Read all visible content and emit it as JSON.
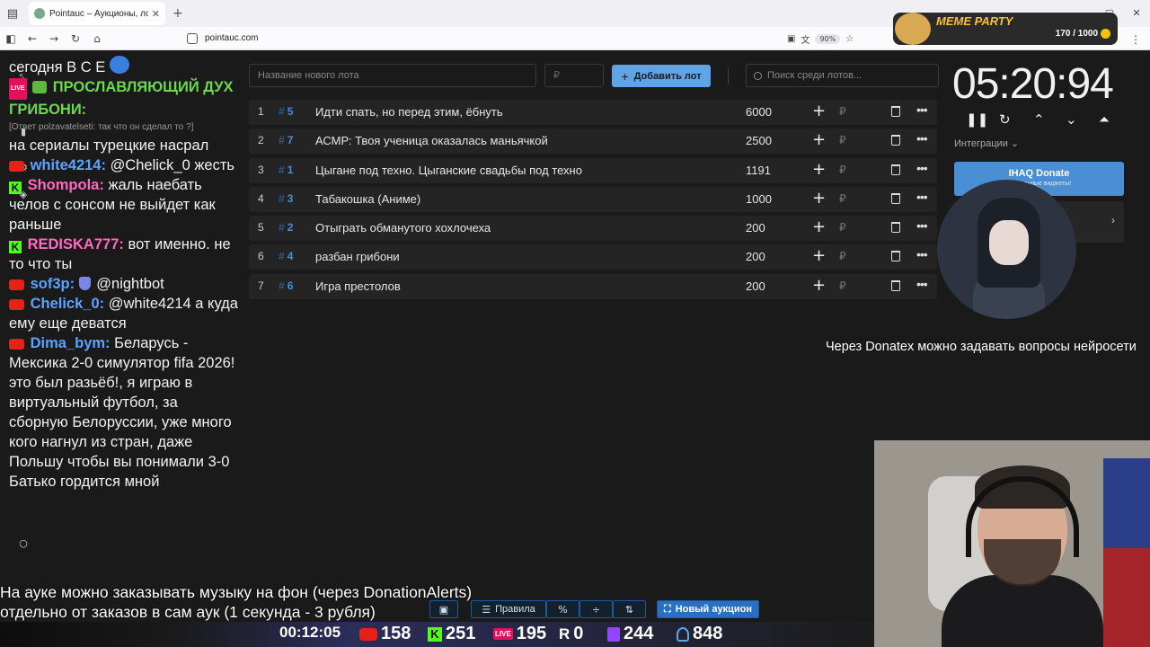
{
  "browser": {
    "tab_title": "Pointauc – Аукционы, лотереи",
    "tab_close": "✕",
    "new_tab": "+",
    "url": "pointauc.com",
    "zoom": "90%"
  },
  "meme_party": {
    "title": "MEME PARTY",
    "count": "170 / 1000"
  },
  "chat": {
    "m1": {
      "text": "сегодня В С Е"
    },
    "m2": {
      "text": "ПРОСЛАВЛЯЮЩИЙ ДУХ ГРИБОНИ:"
    },
    "m3": {
      "reply": "[Ответ polzavatelseti: так что он сделал то ?]",
      "text": "на сериалы турецкие насрал"
    },
    "m4": {
      "nick": "white4214:",
      "text": "@Chelick_0 жесть",
      "nick_color": "#5ea2ff"
    },
    "m5": {
      "nick": "Shompola:",
      "text": "жаль наебать челов с сонсом не выйдет как раньше",
      "nick_color": "#ff6ac0"
    },
    "m6": {
      "nick": "REDISKA777:",
      "text": "вот именно. не то что ты",
      "nick_color": "#ff6ac0"
    },
    "m7": {
      "nick": "sof3p:",
      "text": "@nightbot",
      "nick_color": "#5ea2ff"
    },
    "m8": {
      "nick": "Chelick_0:",
      "text": "@white4214 а куда ему еще деватся",
      "nick_color": "#5ea2ff"
    },
    "m9": {
      "nick": "Dima_bym:",
      "text": "Беларусь - Мексика 2-0 симулятор fifa 2026! это был разьёб!, я играю в виртуальный футбол, за сборную Белоруссии, уже много кого нагнул из стран, даже Польшу чтобы вы понимали 3-0 Батько гордится мной",
      "nick_color": "#5ea2ff"
    }
  },
  "auction": {
    "name_placeholder": "Название нового лота",
    "price_placeholder": "₽",
    "add_label": "Добавить лот",
    "search_placeholder": "Поиск среди лотов...",
    "lots": [
      {
        "n": "1",
        "id": "5",
        "title": "Идти спать, но перед этим, ёбнуть",
        "amount": "6000"
      },
      {
        "n": "2",
        "id": "7",
        "title": "АСМР: Твоя ученица оказалась маньячкой",
        "amount": "2500"
      },
      {
        "n": "3",
        "id": "1",
        "title": "Цыгане под техно. Цыганские свадьбы под техно",
        "amount": "1191"
      },
      {
        "n": "4",
        "id": "3",
        "title": "Табакошка (Аниме)",
        "amount": "1000"
      },
      {
        "n": "5",
        "id": "2",
        "title": "Отыграть обманутого хохлочеха",
        "amount": "200"
      },
      {
        "n": "6",
        "id": "4",
        "title": "разбан грибони",
        "amount": "200"
      },
      {
        "n": "7",
        "id": "6",
        "title": "Игра престолов",
        "amount": "200"
      }
    ],
    "currency": "₽"
  },
  "timer": {
    "value": "05:20:94",
    "integrations": "Интеграции",
    "donate_title": "IHAQ Donate",
    "donate_sub": "уникальные виджеты!"
  },
  "overlay": {
    "donatex": "Через Donatex можно задавать вопросы нейросети",
    "music_line1": "На ауке можно заказывать музыку на фон (через DonationAlerts)",
    "music_line2": "отдельно от заказов в сам аук (1 секунда - 3 рубля)"
  },
  "bottom_toolbar": {
    "rules": "Правила",
    "new_auction": "Новый аукцион"
  },
  "stats": {
    "uptime": "00:12:05",
    "youtube": "158",
    "kick": "251",
    "vk": "195",
    "rutube": "0",
    "twitch": "244",
    "total": "848"
  }
}
